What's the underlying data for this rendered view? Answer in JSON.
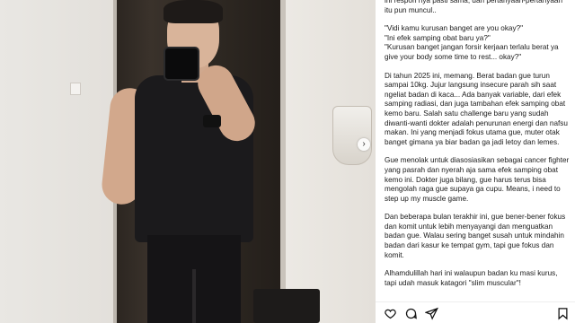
{
  "caption": {
    "paragraphs": [
      "ini respon nya pasti sama, dan pertanyaan-pertanyaan itu pun muncul..",
      "\"Vidi kamu kurusan banget are you okay?\"\n\"Ini efek samping obat baru ya?\"\n\"Kurusan banget jangan forsir kerjaan terlalu berat ya give your body some time to rest... okay?\"",
      "Di tahun 2025 ini, memang. Berat badan gue turun sampai 10kg. Jujur langsung insecure parah sih saat ngeliat badan di kaca... Ada banyak variable, dari efek samping radiasi, dan juga tambahan efek samping obat kemo baru. Salah satu challenge baru yang sudah diwanti-wanti dokter adalah penurunan energi dan nafsu makan. Ini yang menjadi fokus utama gue, muter otak banget gimana ya biar badan ga jadi letoy dan lemes.",
      "Gue menolak untuk diasosiasikan sebagai cancer fighter yang pasrah dan nyerah aja sama efek samping obat kemo ini. Dokter juga bilang, gue harus terus bisa mengolah raga gue supaya ga cupu. Means, i need to step up my muscle game.",
      "Dan beberapa bulan terakhir ini, gue bener-bener fokus dan komit untuk lebih menyayangi dan menguatkan badan gue. Walau sering banget susah untuk mindahin badan dari kasur ke tempat gym, tapi gue fokus dan komit.",
      "Alhamdulillah hari ini walaupun badan ku masi kurus, tapi udah masuk katagori \"slim muscular\"!"
    ]
  },
  "icons": {
    "like": "heart-icon",
    "comment": "comment-icon",
    "share": "share-icon",
    "save": "bookmark-icon",
    "next": "chevron-right-icon"
  },
  "carousel": {
    "next_glyph": "›"
  }
}
